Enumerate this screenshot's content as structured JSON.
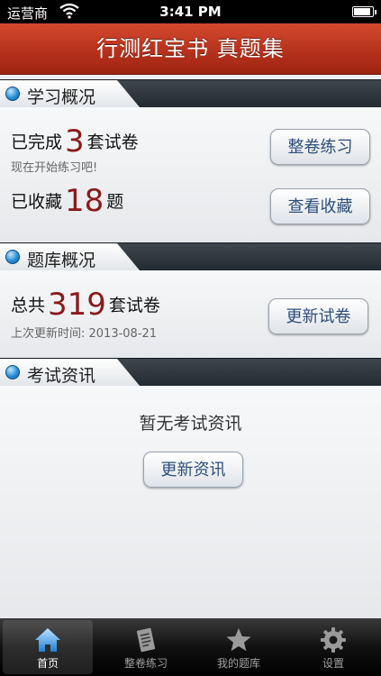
{
  "status_bar": {
    "carrier": "运营商",
    "time": "3:41 PM"
  },
  "header": {
    "title": "行测红宝书 真题集"
  },
  "study": {
    "section_title": "学习概况",
    "completed_prefix": "已完成",
    "completed_count": "3",
    "completed_suffix": "套试卷",
    "hint": "现在开始练习吧!",
    "favorites_prefix": "已收藏",
    "favorites_count": "18",
    "favorites_suffix": "题",
    "practice_button": "整卷练习",
    "view_favorites_button": "查看收藏"
  },
  "bank": {
    "section_title": "题库概况",
    "total_prefix": "总共",
    "total_count": "319",
    "total_suffix": "套试卷",
    "last_update": "上次更新时间: 2013-08-21",
    "update_button": "更新试卷"
  },
  "news": {
    "section_title": "考试资讯",
    "empty_text": "暂无考试资讯",
    "update_button": "更新资讯"
  },
  "tabs": [
    {
      "label": "首页",
      "icon": "home-icon",
      "active": true
    },
    {
      "label": "整卷练习",
      "icon": "exam-paper-icon",
      "active": false
    },
    {
      "label": "我的题库",
      "icon": "star-icon",
      "active": false
    },
    {
      "label": "设置",
      "icon": "gear-icon",
      "active": false
    }
  ],
  "colors": {
    "title_bar": "#b6321c",
    "number_accent": "#8b1a1a",
    "button_text": "#2c4e7c"
  }
}
